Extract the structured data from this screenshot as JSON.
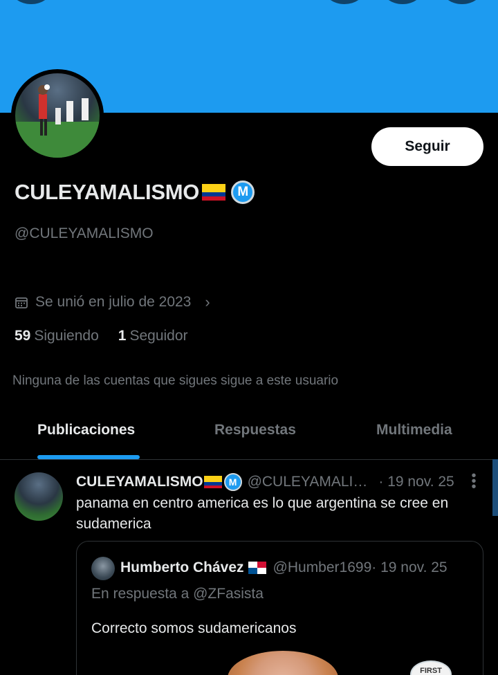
{
  "profile": {
    "display_name": "CULEYAMALISMO",
    "handle": "@CULEYAMALISMO",
    "joined": "Se unió en julio de 2023",
    "following_count": "59",
    "following_label": "Siguiendo",
    "followers_count": "1",
    "followers_label": "Seguidor",
    "mutual_text": "Ninguna de las cuentas que sigues sigue a este usuario",
    "follow_button": "Seguir"
  },
  "tabs": [
    {
      "label": "Publicaciones",
      "active": true
    },
    {
      "label": "Respuestas",
      "active": false
    },
    {
      "label": "Multimedia",
      "active": false
    }
  ],
  "post": {
    "author": "CULEYAMALISMO",
    "handle": "@CULEYAMALI…",
    "time": "· 19 nov. 25",
    "text": "panama en centro america es lo que argentina se cree en sudamerica",
    "quote": {
      "author": "Humberto Chávez",
      "handle": "@Humber1699",
      "time": "· 19 nov. 25",
      "reply_to": "En respuesta a @ZFasista",
      "text": "Correcto somos sudamericanos",
      "stamp_text": "FIRST"
    }
  },
  "badge_letter": "M",
  "colors": {
    "accent": "#1d9bf0",
    "background": "#000000",
    "text_primary": "#e7e9ea",
    "text_secondary": "#71767b"
  },
  "icons": [
    "calendar-icon",
    "chevron-right-icon",
    "more-vertical-icon",
    "verified-m-badge-icon",
    "colombia-flag-icon",
    "panama-flag-icon"
  ]
}
